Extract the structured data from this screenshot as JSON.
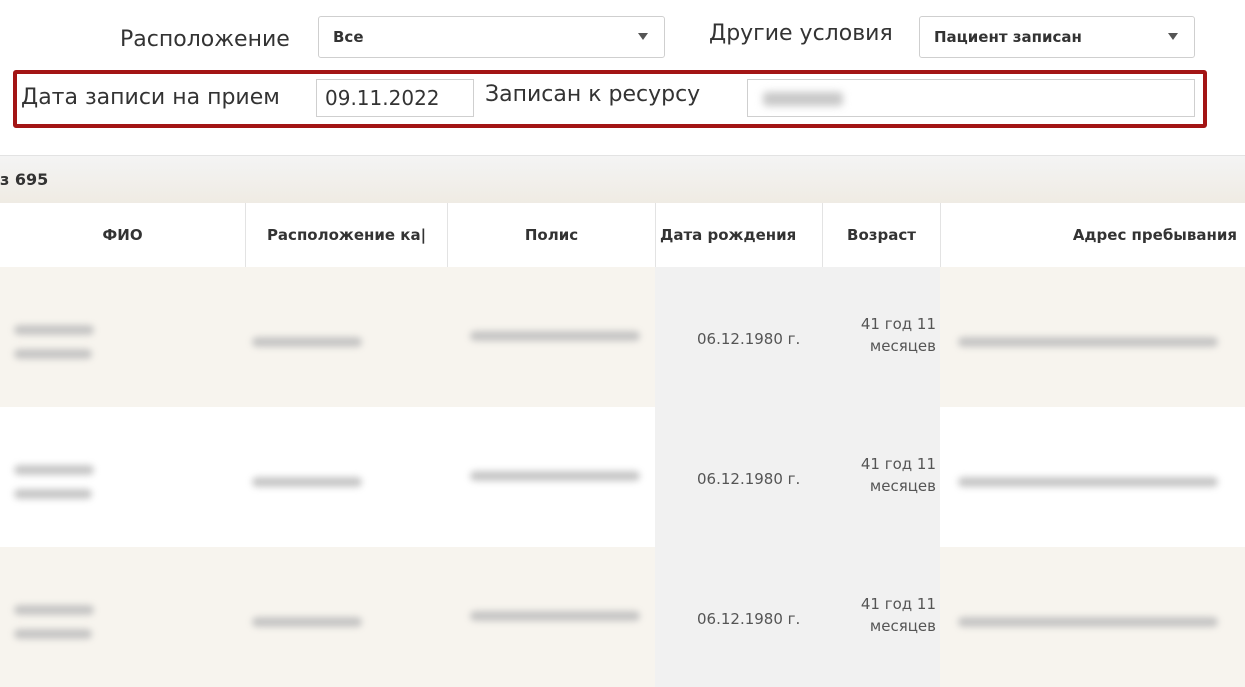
{
  "filters": {
    "location_label": "Расположение",
    "location_value": "Все",
    "other_conditions_label": "Другие условия",
    "other_conditions_value": "Пациент записан",
    "appointment_date_label": "Дата записи на прием",
    "appointment_date_value": "09.11.2022",
    "resource_label": "Записан к ресурсу"
  },
  "table": {
    "count_text": "з 695",
    "headers": [
      "ФИО",
      "Расположение ка|",
      "Полис",
      "Дата рождения",
      "Возраст",
      "Адрес пребывания"
    ],
    "rows": [
      {
        "birth_date": "06.12.1980 г.",
        "age_line1": "41 год 11",
        "age_line2": "месяцев"
      },
      {
        "birth_date": "06.12.1980 г.",
        "age_line1": "41 год 11",
        "age_line2": "месяцев"
      },
      {
        "birth_date": "06.12.1980 г.",
        "age_line1": "41 год 11",
        "age_line2": "месяцев"
      }
    ]
  },
  "colors": {
    "highlight_border": "#a31515",
    "row_stripe": "#f7f4ee",
    "header_bar": "#efebe3"
  }
}
